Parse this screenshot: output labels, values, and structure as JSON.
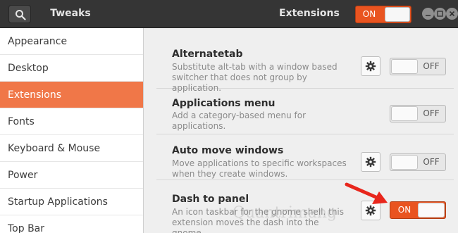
{
  "header": {
    "title": "Tweaks",
    "subtitle": "Extensions",
    "global_switch_label": "ON",
    "global_switch_state": "on",
    "search_icon": "search-icon",
    "window_controls": [
      "minimize-icon",
      "maximize-icon",
      "close-icon"
    ]
  },
  "sidebar": {
    "items": [
      {
        "label": "Appearance",
        "selected": false
      },
      {
        "label": "Desktop",
        "selected": false
      },
      {
        "label": "Extensions",
        "selected": true
      },
      {
        "label": "Fonts",
        "selected": false
      },
      {
        "label": "Keyboard & Mouse",
        "selected": false
      },
      {
        "label": "Power",
        "selected": false
      },
      {
        "label": "Startup Applications",
        "selected": false
      },
      {
        "label": "Top Bar",
        "selected": false
      }
    ]
  },
  "extensions": [
    {
      "title": "Alternatetab",
      "desc_lines": [
        "Substitute alt-tab with a window based",
        "switcher that does not group by application."
      ],
      "has_settings": true,
      "switch_label": "OFF",
      "state": "off"
    },
    {
      "title": "Applications menu",
      "desc_lines": [
        "Add a category-based menu for applications."
      ],
      "has_settings": false,
      "switch_label": "OFF",
      "state": "off"
    },
    {
      "title": "Auto move windows",
      "desc_lines": [
        "Move applications to specific workspaces",
        "when they create windows."
      ],
      "has_settings": true,
      "switch_label": "OFF",
      "state": "off"
    },
    {
      "title": "Dash to panel",
      "desc_lines": [
        "An icon taskbar for the gnome shell. this",
        "extension moves the dash into the gnome..."
      ],
      "has_settings": true,
      "switch_label": "ON",
      "state": "on"
    }
  ],
  "colors": {
    "accent": "#e95420",
    "selected_sidebar": "#f07748",
    "headerbar": "#353535",
    "annotation_arrow": "#e8261c"
  },
  "watermark": "Quantrimang"
}
